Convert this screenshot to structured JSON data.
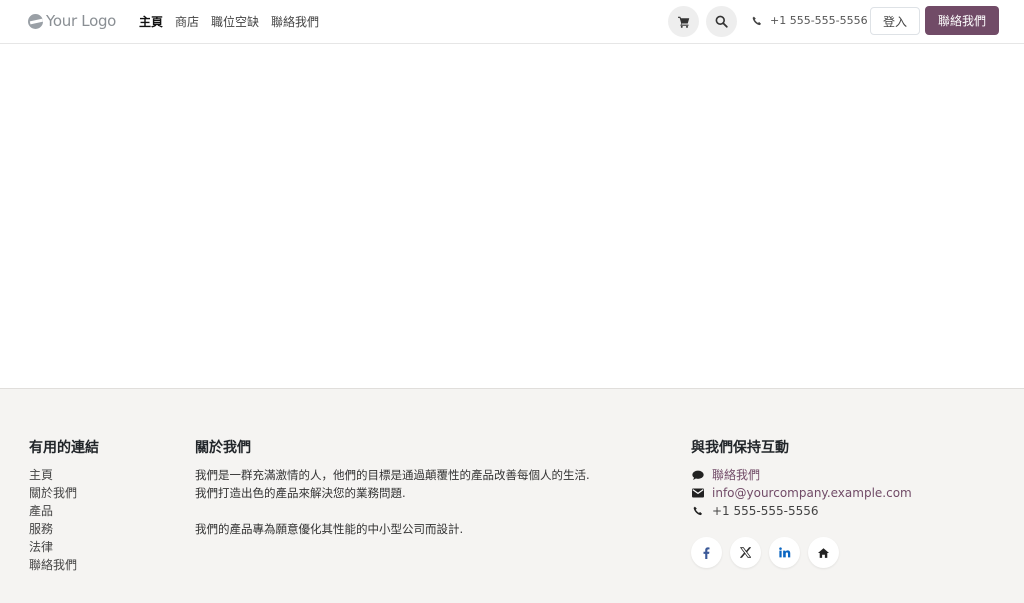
{
  "header": {
    "logo_text": "Your Logo",
    "nav": [
      {
        "label": "主頁",
        "active": true
      },
      {
        "label": "商店",
        "active": false
      },
      {
        "label": "職位空缺",
        "active": false
      },
      {
        "label": "聯絡我們",
        "active": false
      }
    ],
    "phone": "+1 555-555-5556",
    "login_label": "登入",
    "contact_label": "聯絡我們"
  },
  "footer": {
    "links": {
      "title": "有用的連結",
      "items": [
        "主頁",
        "關於我們",
        "產品",
        "服務",
        "法律",
        "聯絡我們"
      ]
    },
    "about": {
      "title": "關於我們",
      "paragraph1": "我們是一群充滿激情的人，他們的目標是通過顛覆性的產品改善每個人的生活.我們打造出色的產品來解決您的業務問題.",
      "paragraph2": "我們的產品專為願意優化其性能的中小型公司而設計."
    },
    "connect": {
      "title": "與我們保持互動",
      "contact_label": "聯絡我們",
      "email": "info@yourcompany.example.com",
      "phone": "+1 555-555-5556",
      "socials": [
        "facebook-icon",
        "x-twitter-icon",
        "linkedin-icon",
        "home-icon"
      ]
    }
  },
  "colors": {
    "brand": "#714b67",
    "footer_bg": "#f5f4f2"
  }
}
